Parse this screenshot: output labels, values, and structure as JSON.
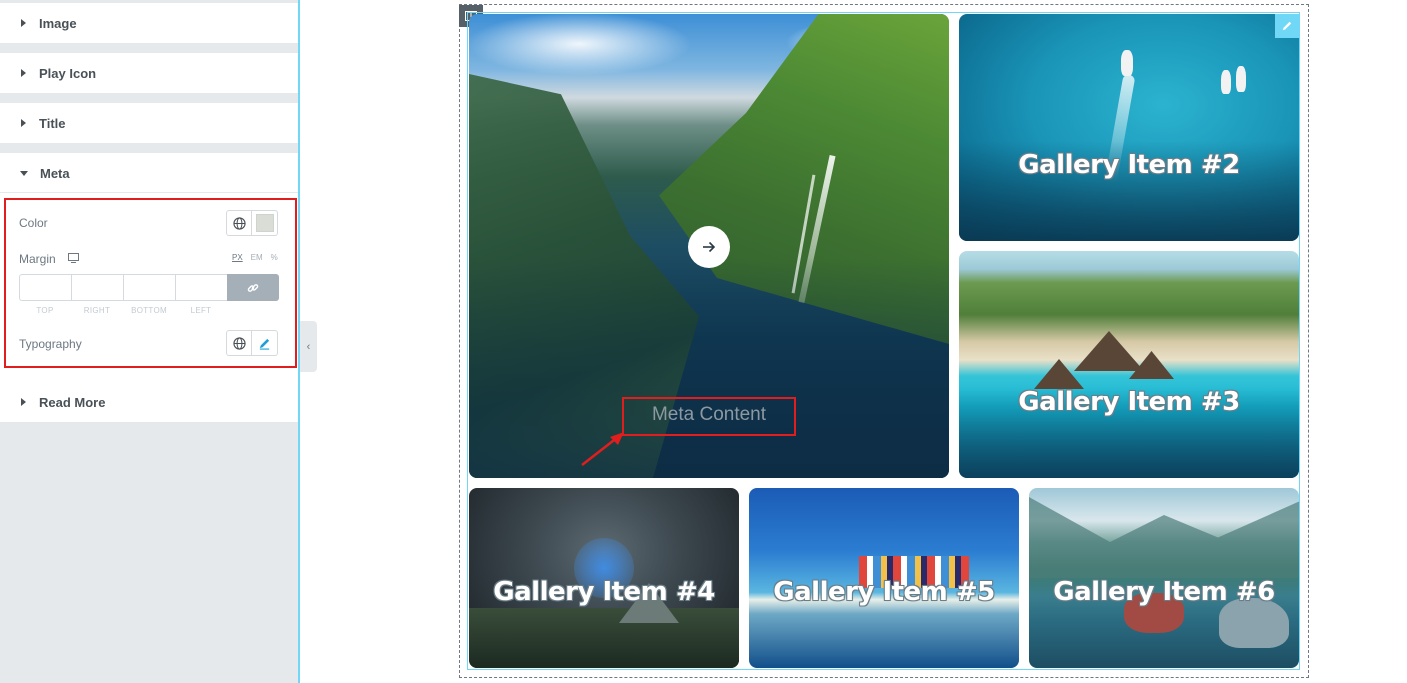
{
  "panel": {
    "sections": {
      "image": "Image",
      "play_icon": "Play Icon",
      "title": "Title",
      "meta": "Meta",
      "read_more": "Read More"
    },
    "meta_controls": {
      "color_label": "Color",
      "margin_label": "Margin",
      "units": [
        "PX",
        "EM",
        "%"
      ],
      "active_unit": "PX",
      "dimension_labels": [
        "TOP",
        "RIGHT",
        "BOTTOM",
        "LEFT"
      ],
      "typography_label": "Typography"
    },
    "colors": {
      "accent": "#71d7f7",
      "highlight": "#e01e1e",
      "swatch": "#d9ddd6"
    }
  },
  "gallery": {
    "items": [
      {
        "meta": "Meta Content"
      },
      {
        "title": "Gallery Item #2"
      },
      {
        "title": "Gallery Item #3"
      },
      {
        "title": "Gallery Item #4"
      },
      {
        "title": "Gallery Item #5"
      },
      {
        "title": "Gallery Item #6"
      }
    ],
    "icons": {
      "play": "arrow-right-icon",
      "column_handle": "columns-icon",
      "widget_edit": "pencil-icon"
    }
  }
}
